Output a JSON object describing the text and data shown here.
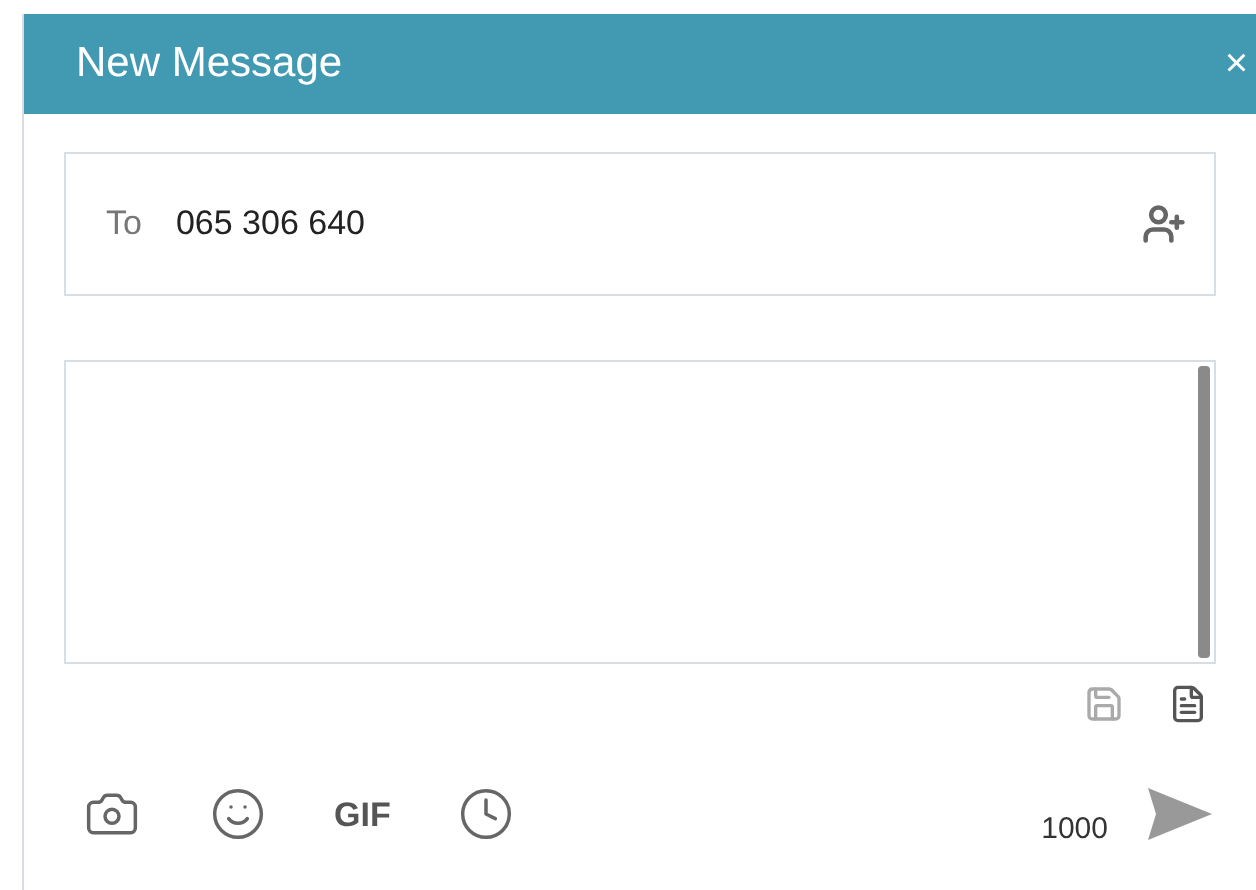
{
  "dialog": {
    "title": "New Message",
    "close": "×"
  },
  "recipient": {
    "label": "To",
    "value": "065 306 640"
  },
  "toolbar": {
    "gif": "GIF",
    "counter": "1000"
  }
}
